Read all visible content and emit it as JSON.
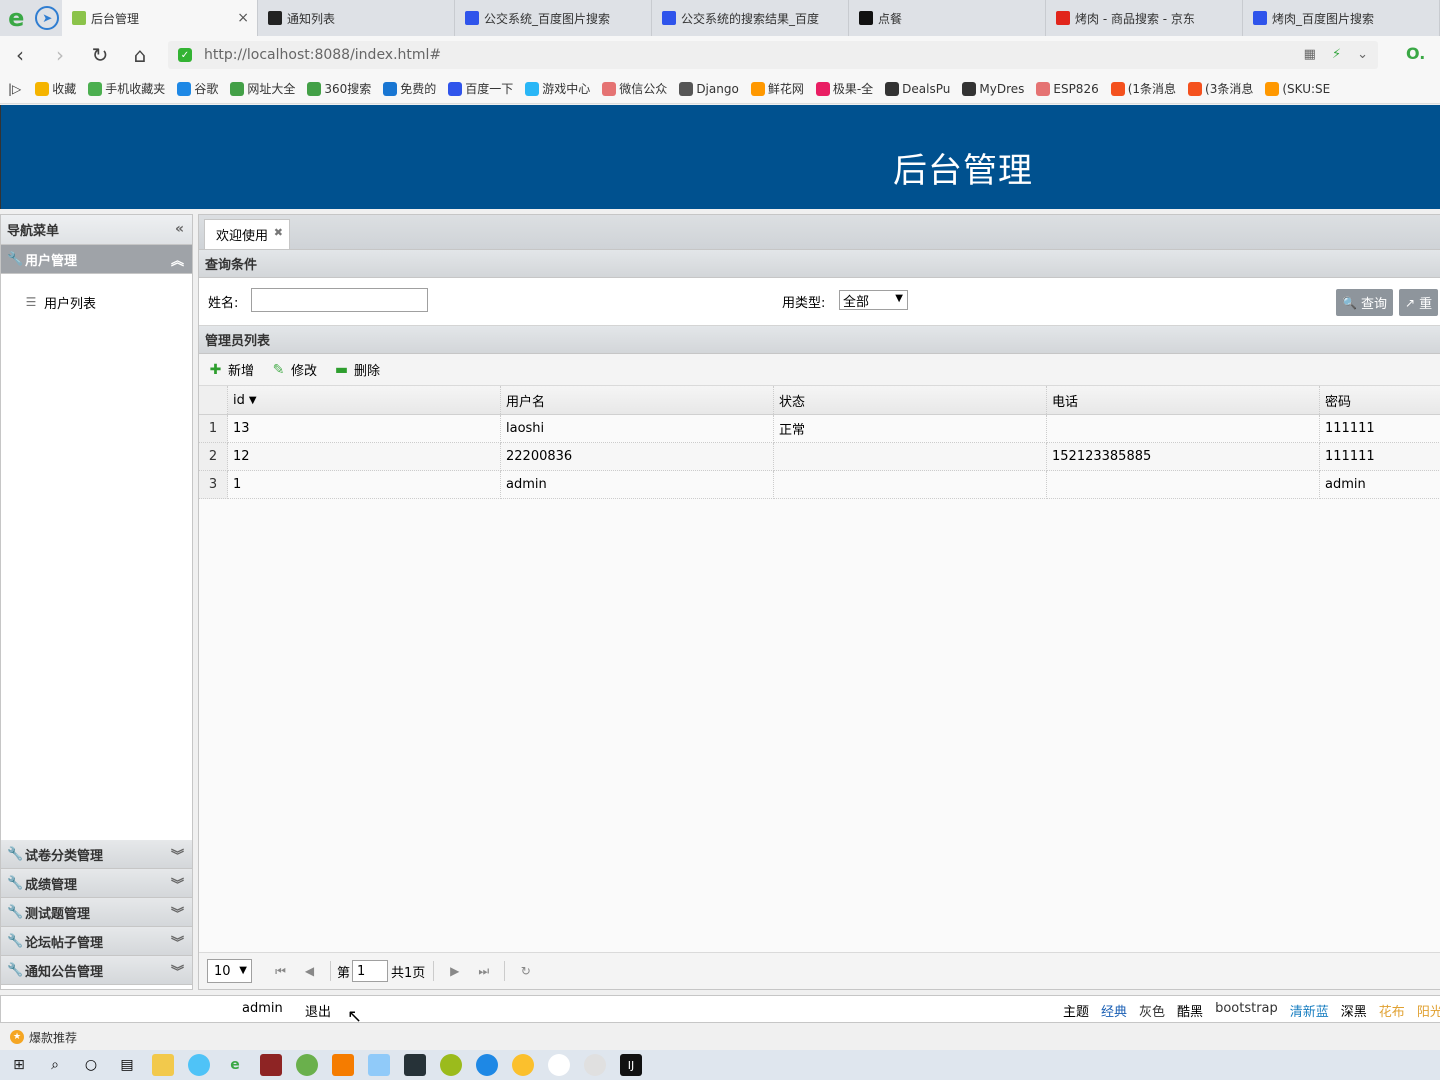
{
  "browser": {
    "tabs": [
      {
        "label": "后台管理",
        "fav_color": "#8bc34a",
        "active": true
      },
      {
        "label": "通知列表",
        "fav_color": "#222222"
      },
      {
        "label": "公交系统_百度图片搜索",
        "fav_color": "#2f54eb"
      },
      {
        "label": "公交系统的搜索结果_百度",
        "fav_color": "#2f54eb"
      },
      {
        "label": "点餐",
        "fav_color": "#111111"
      },
      {
        "label": "烤肉 - 商品搜索 - 京东",
        "fav_color": "#e1251b"
      },
      {
        "label": "烤肉_百度图片搜索",
        "fav_color": "#2f54eb"
      }
    ],
    "tab_close": "×",
    "url": "http://localhost:8088/index.html#",
    "bookmarks": [
      {
        "label": "收藏",
        "color": "#f5b400"
      },
      {
        "label": "手机收藏夹",
        "color": "#4caf50"
      },
      {
        "label": "谷歌",
        "color": "#1e88e5"
      },
      {
        "label": "网址大全",
        "color": "#43a047"
      },
      {
        "label": "360搜索",
        "color": "#43a047"
      },
      {
        "label": "免费的",
        "color": "#1976d2"
      },
      {
        "label": "百度一下",
        "color": "#2f54eb"
      },
      {
        "label": "游戏中心",
        "color": "#29b6f6"
      },
      {
        "label": "微信公众",
        "color": "#e57373"
      },
      {
        "label": "Django",
        "color": "#555555"
      },
      {
        "label": "鲜花网",
        "color": "#ff9800"
      },
      {
        "label": "极果-全",
        "color": "#e91e63"
      },
      {
        "label": "DealsPu",
        "color": "#333333"
      },
      {
        "label": "MyDres",
        "color": "#333333"
      },
      {
        "label": "ESP826",
        "color": "#e57373"
      },
      {
        "label": "(1条消息",
        "color": "#f4511e"
      },
      {
        "label": "(3条消息",
        "color": "#f4511e"
      },
      {
        "label": "(SKU:SE",
        "color": "#ff9800"
      }
    ]
  },
  "app": {
    "title": "后台管理",
    "nav": {
      "title": "导航菜单",
      "sections": [
        {
          "label": "用户管理",
          "expanded": true,
          "items": [
            "用户列表"
          ]
        },
        {
          "label": "试卷分类管理"
        },
        {
          "label": "成绩管理"
        },
        {
          "label": "测试题管理"
        },
        {
          "label": "论坛帖子管理"
        },
        {
          "label": "通知公告管理"
        }
      ]
    },
    "tab": {
      "label": "欢迎使用"
    },
    "query": {
      "title": "查询条件",
      "name_label": "姓名:",
      "name_value": "",
      "type_label": "用类型:",
      "type_value": "全部",
      "search_btn": "查询",
      "reset_btn": "重"
    },
    "list": {
      "title": "管理员列表",
      "toolbar": {
        "add": "新增",
        "edit": "修改",
        "delete": "删除"
      },
      "columns": [
        "id",
        "用户名",
        "状态",
        "电话",
        "密码"
      ],
      "rows": [
        {
          "rn": "1",
          "id": "13",
          "username": "laoshi",
          "status": "正常",
          "phone": "",
          "password": "111111"
        },
        {
          "rn": "2",
          "id": "12",
          "username": "22200836",
          "status": "",
          "phone": "152123385885",
          "password": "111111"
        },
        {
          "rn": "3",
          "id": "1",
          "username": "admin",
          "status": "",
          "phone": "",
          "password": "admin"
        }
      ]
    },
    "pager": {
      "page_size": "10",
      "page_prefix": "第",
      "page_number": "1",
      "page_total": "共1页"
    },
    "footer": {
      "user": "admin",
      "logout": "退出",
      "themes_label": "主题",
      "themes": [
        {
          "label": "经典",
          "color": "#1a5fb4"
        },
        {
          "label": "灰色",
          "color": "#333333"
        },
        {
          "label": "酷黑",
          "color": "#000000"
        },
        {
          "label": "bootstrap",
          "color": "#333333"
        },
        {
          "label": "清新蓝",
          "color": "#1a7fc1"
        },
        {
          "label": "深黑",
          "color": "#000000"
        },
        {
          "label": "花布",
          "color": "#e0a030"
        },
        {
          "label": "阳光",
          "color": "#e0a030"
        }
      ]
    }
  },
  "status_bar": {
    "label": "爆款推荐"
  }
}
